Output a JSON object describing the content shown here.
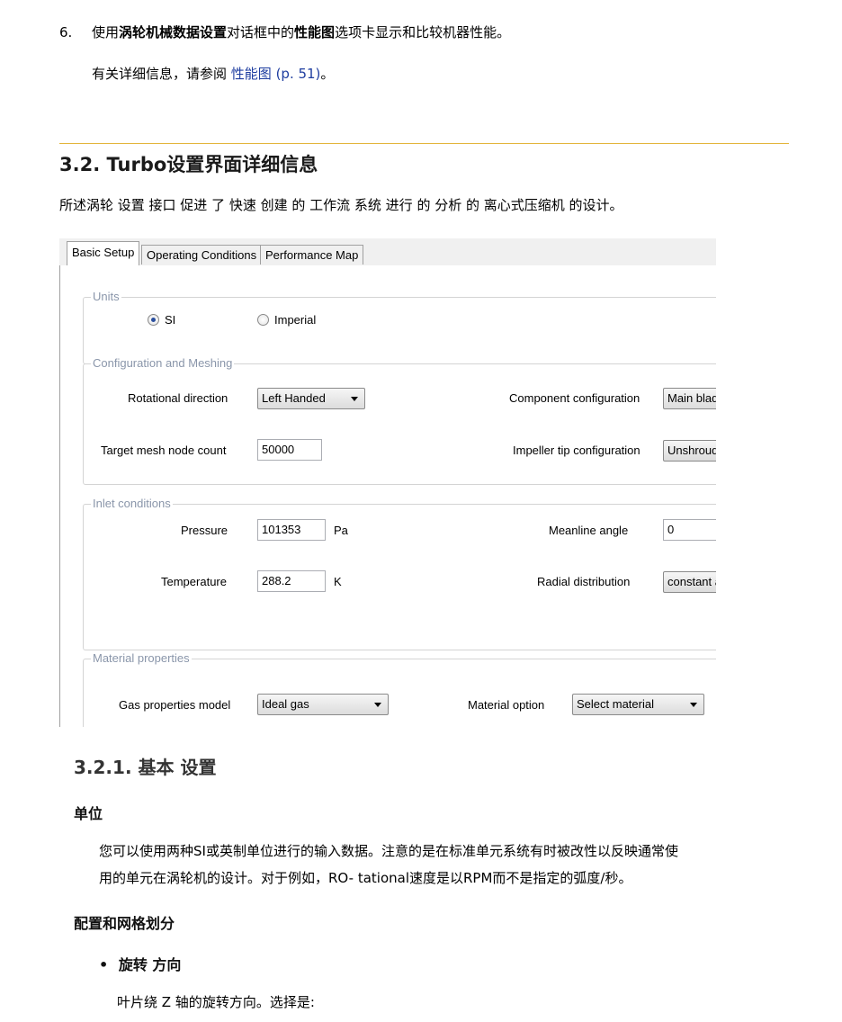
{
  "step6": {
    "number": "6.",
    "pre": "使用",
    "dialog_name": "涡轮机械数据设置",
    "mid": "对话框中的",
    "tab_name": "性能图",
    "post": "选项卡显示和比较机器性能。"
  },
  "details": {
    "pre": "有关详细信息，请参阅 ",
    "link": "性能图",
    "ref": " (p. 51)",
    "post": "。"
  },
  "section_heading": "3.2. Turbo设置界面详细信息",
  "section_intro": "所述涡轮 设置 接口 促进 了 快速 创建 的 工作流 系统 进行 的 分析 的 离心式压缩机 的设计。",
  "dialog": {
    "tabs": [
      "Basic Setup",
      "Operating Conditions",
      "Performance Map"
    ],
    "units": {
      "legend": "Units",
      "si_label": "SI",
      "imperial_label": "Imperial",
      "selected": "SI"
    },
    "config": {
      "legend": "Configuration and Meshing",
      "rotational_direction_label": "Rotational direction",
      "rotational_direction_value": "Left Handed",
      "target_mesh_label": "Target mesh node count",
      "target_mesh_value": "50000",
      "component_config_label": "Component configuration",
      "component_config_value": "Main blad",
      "impeller_tip_label": "Impeller tip configuration",
      "impeller_tip_value": "Unshroud"
    },
    "inlet": {
      "legend": "Inlet conditions",
      "pressure_label": "Pressure",
      "pressure_value": "101353",
      "pressure_unit": "Pa",
      "temperature_label": "Temperature",
      "temperature_value": "288.2",
      "temperature_unit": "K",
      "meanline_label": "Meanline angle",
      "meanline_value": "0",
      "radial_label": "Radial distribution",
      "radial_value": "constant a"
    },
    "material": {
      "legend": "Material properties",
      "gas_model_label": "Gas properties model",
      "gas_model_value": "Ideal gas",
      "material_option_label": "Material option",
      "material_option_value": "Select material"
    }
  },
  "subsection_heading": "3.2.1. 基本 设置",
  "units_heading": "单位",
  "units_para_line1": "您可以使用两种SI或英制单位进行的输入数据。注意的是在标准单元系统有时被改性以反映通常使",
  "units_para_line2": "用的单元在涡轮机的设计。对于例如，RO- tational速度是以RPM而不是指定的弧度/秒。",
  "config_heading": "配置和网格划分",
  "bullet_symbol": "•",
  "bullet_rotation": "旋转 方向",
  "rotation_desc": "叶片绕 Z 轴的旋转方向。选择是:",
  "colors": {
    "rule": "#e3b53b",
    "link": "#1f3ea0",
    "legend": "#8a96aa"
  }
}
